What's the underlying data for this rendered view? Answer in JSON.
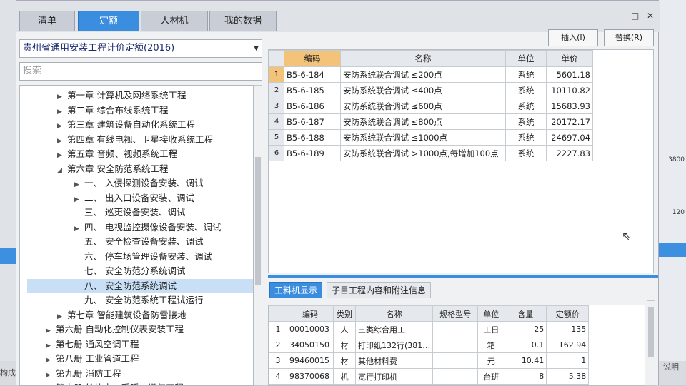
{
  "tabs": {
    "qingdan": "清单",
    "dinge": "定额",
    "rencaiji": "人材机",
    "mydata": "我的数据"
  },
  "window": {
    "restore_icon": "□",
    "close_icon": "✕"
  },
  "quota_book": "贵州省通用安装工程计价定额(2016)",
  "search_placeholder": "搜索",
  "tree": [
    {
      "label": "第一章 计算机及网络系统工程",
      "indent": 1,
      "expander": "▶",
      "selected": false
    },
    {
      "label": "第二章 综合布线系统工程",
      "indent": 1,
      "expander": "▶",
      "selected": false
    },
    {
      "label": "第三章 建筑设备自动化系统工程",
      "indent": 1,
      "expander": "▶",
      "selected": false
    },
    {
      "label": "第四章 有线电视、卫星接收系统工程",
      "indent": 1,
      "expander": "▶",
      "selected": false
    },
    {
      "label": "第五章 音频、视频系统工程",
      "indent": 1,
      "expander": "▶",
      "selected": false
    },
    {
      "label": "第六章 安全防范系统工程",
      "indent": 1,
      "expander": "◢",
      "selected": false
    },
    {
      "label": "一、 入侵探测设备安装、调试",
      "indent": 2,
      "expander": "▶",
      "selected": false
    },
    {
      "label": "二、 出入口设备安装、调试",
      "indent": 2,
      "expander": "▶",
      "selected": false
    },
    {
      "label": "三、 巡更设备安装、调试",
      "indent": 2,
      "expander": "",
      "selected": false
    },
    {
      "label": "四、 电视监控摄像设备安装、调试",
      "indent": 2,
      "expander": "▶",
      "selected": false
    },
    {
      "label": "五、 安全检查设备安装、调试",
      "indent": 2,
      "expander": "",
      "selected": false
    },
    {
      "label": "六、 停车场管理设备安装、调试",
      "indent": 2,
      "expander": "",
      "selected": false
    },
    {
      "label": "七、 安全防范分系统调试",
      "indent": 2,
      "expander": "",
      "selected": false
    },
    {
      "label": "八、 安全防范系统调试",
      "indent": 2,
      "expander": "",
      "selected": true
    },
    {
      "label": "九、 安全防范系统工程试运行",
      "indent": 2,
      "expander": "",
      "selected": false
    },
    {
      "label": "第七章 智能建筑设备防雷接地",
      "indent": 1,
      "expander": "▶",
      "selected": false
    },
    {
      "label": "第六册 自动化控制仪表安装工程",
      "indent": 0,
      "expander": "▶",
      "selected": false
    },
    {
      "label": "第七册 通风空调工程",
      "indent": 0,
      "expander": "▶",
      "selected": false
    },
    {
      "label": "第八册 工业管道工程",
      "indent": 0,
      "expander": "▶",
      "selected": false
    },
    {
      "label": "第九册 消防工程",
      "indent": 0,
      "expander": "▶",
      "selected": false
    },
    {
      "label": "第十册 给排水、采暖、燃气工程",
      "indent": 0,
      "expander": "▶",
      "selected": false
    }
  ],
  "buttons": {
    "insert": "插入(I)",
    "replace": "替换(R)"
  },
  "quota_grid": {
    "headers": {
      "code": "编码",
      "name": "名称",
      "unit": "单位",
      "price": "单价"
    },
    "rows": [
      {
        "no": "1",
        "code": "B5-6-184",
        "name": "安防系统联合调试 ≤200点",
        "unit": "系统",
        "price": "5601.18"
      },
      {
        "no": "2",
        "code": "B5-6-185",
        "name": "安防系统联合调试 ≤400点",
        "unit": "系统",
        "price": "10110.82"
      },
      {
        "no": "3",
        "code": "B5-6-186",
        "name": "安防系统联合调试 ≤600点",
        "unit": "系统",
        "price": "15683.93"
      },
      {
        "no": "4",
        "code": "B5-6-187",
        "name": "安防系统联合调试 ≤800点",
        "unit": "系统",
        "price": "20172.17"
      },
      {
        "no": "5",
        "code": "B5-6-188",
        "name": "安防系统联合调试 ≤1000点",
        "unit": "系统",
        "price": "24697.04"
      },
      {
        "no": "6",
        "code": "B5-6-189",
        "name": "安防系统联合调试 >1000点,每增加100点",
        "unit": "系统",
        "price": "2227.83"
      }
    ]
  },
  "subtabs": {
    "labor_material": "工料机显示",
    "content_notes": "子目工程内容和附注信息"
  },
  "lm_grid": {
    "headers": {
      "code": "编码",
      "category": "类别",
      "name": "名称",
      "spec": "规格型号",
      "unit": "单位",
      "qty": "含量",
      "price": "定额价"
    },
    "rows": [
      {
        "no": "1",
        "code": "00010003",
        "category": "人",
        "name": "三类综合用工",
        "spec": "",
        "unit": "工日",
        "qty": "25",
        "price": "135"
      },
      {
        "no": "2",
        "code": "34050150",
        "category": "材",
        "name": "打印纸132行(381…",
        "spec": "",
        "unit": "箱",
        "qty": "0.1",
        "price": "162.94"
      },
      {
        "no": "3",
        "code": "99460015",
        "category": "材",
        "name": "其他材料费",
        "spec": "",
        "unit": "元",
        "qty": "10.41",
        "price": "1"
      },
      {
        "no": "4",
        "code": "98370068",
        "category": "机",
        "name": "宽行打印机",
        "spec": "",
        "unit": "台班",
        "qty": "8",
        "price": "5.38"
      }
    ]
  },
  "background": {
    "right_vals": [
      "3800",
      "120"
    ],
    "bottom_left": "构成",
    "bottom_right": "说明"
  },
  "colors": {
    "accent": "#3b8de0",
    "selected_header": "#f3c37a"
  }
}
